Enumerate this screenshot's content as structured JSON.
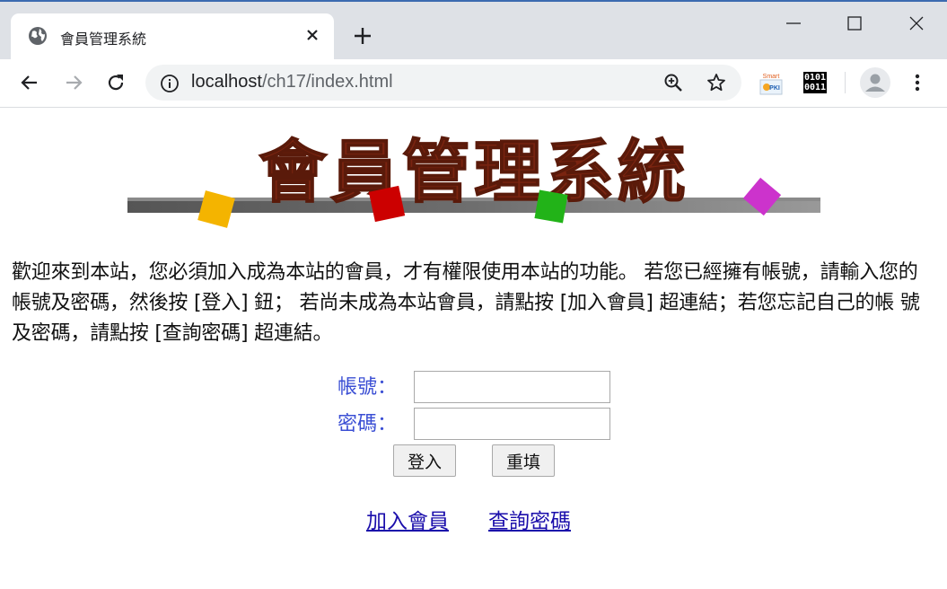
{
  "browser": {
    "tab_title": "會員管理系統",
    "url_host": "localhost",
    "url_path": "/ch17/index.html",
    "extensions": {
      "smart_pki_line1": "Smart",
      "smart_pki_line2": "PKI",
      "binary_line1": "0101",
      "binary_line2": "0011"
    },
    "accent_color": "#3c6bb0"
  },
  "page": {
    "logo_text": "會員管理系統",
    "intro": "歡迎來到本站，您必須加入成為本站的會員，才有權限使用本站的功能。 若您已經擁有帳號，請輸入您的帳號及密碼，然後按 [登入] 鈕； 若尚未成為本站會員，請點按 [加入會員] 超連結；若您忘記自己的帳 號及密碼，請點按 [查詢密碼] 超連結。",
    "form": {
      "account_label": "帳號：",
      "account_value": "",
      "password_label": "密碼：",
      "password_value": "",
      "login_button": "登入",
      "reset_button": "重填"
    },
    "links": {
      "join": "加入會員",
      "query_password": "查詢密碼"
    },
    "colors": {
      "label": "#3b4fd4",
      "link": "#1a0dab",
      "logo_text": "#7a2410"
    }
  }
}
